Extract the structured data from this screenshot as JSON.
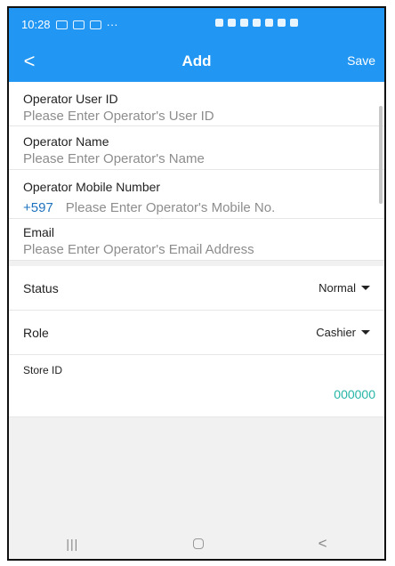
{
  "status_bar": {
    "time": "10:28",
    "more": "···"
  },
  "app_bar": {
    "back_glyph": "<",
    "title": "Add",
    "save_label": "Save"
  },
  "form": {
    "operator_user_id": {
      "label": "Operator User ID",
      "placeholder": "Please Enter Operator's User ID"
    },
    "operator_name": {
      "label": "Operator Name",
      "placeholder": "Please Enter Operator's Name"
    },
    "operator_mobile": {
      "label": "Operator Mobile Number",
      "country_code": "+597",
      "placeholder": "Please Enter Operator's Mobile No."
    },
    "email": {
      "label": "Email",
      "placeholder": "Please Enter Operator's Email Address"
    },
    "status": {
      "label": "Status",
      "value": "Normal"
    },
    "role": {
      "label": "Role",
      "value": "Cashier"
    },
    "store_id": {
      "label": "Store ID",
      "value": "000000"
    }
  },
  "nav_bar": {
    "recents": "|||",
    "back": "<"
  },
  "colors": {
    "accent": "#2196f3",
    "store_value": "#26b5a6",
    "country_code": "#1e73be"
  }
}
